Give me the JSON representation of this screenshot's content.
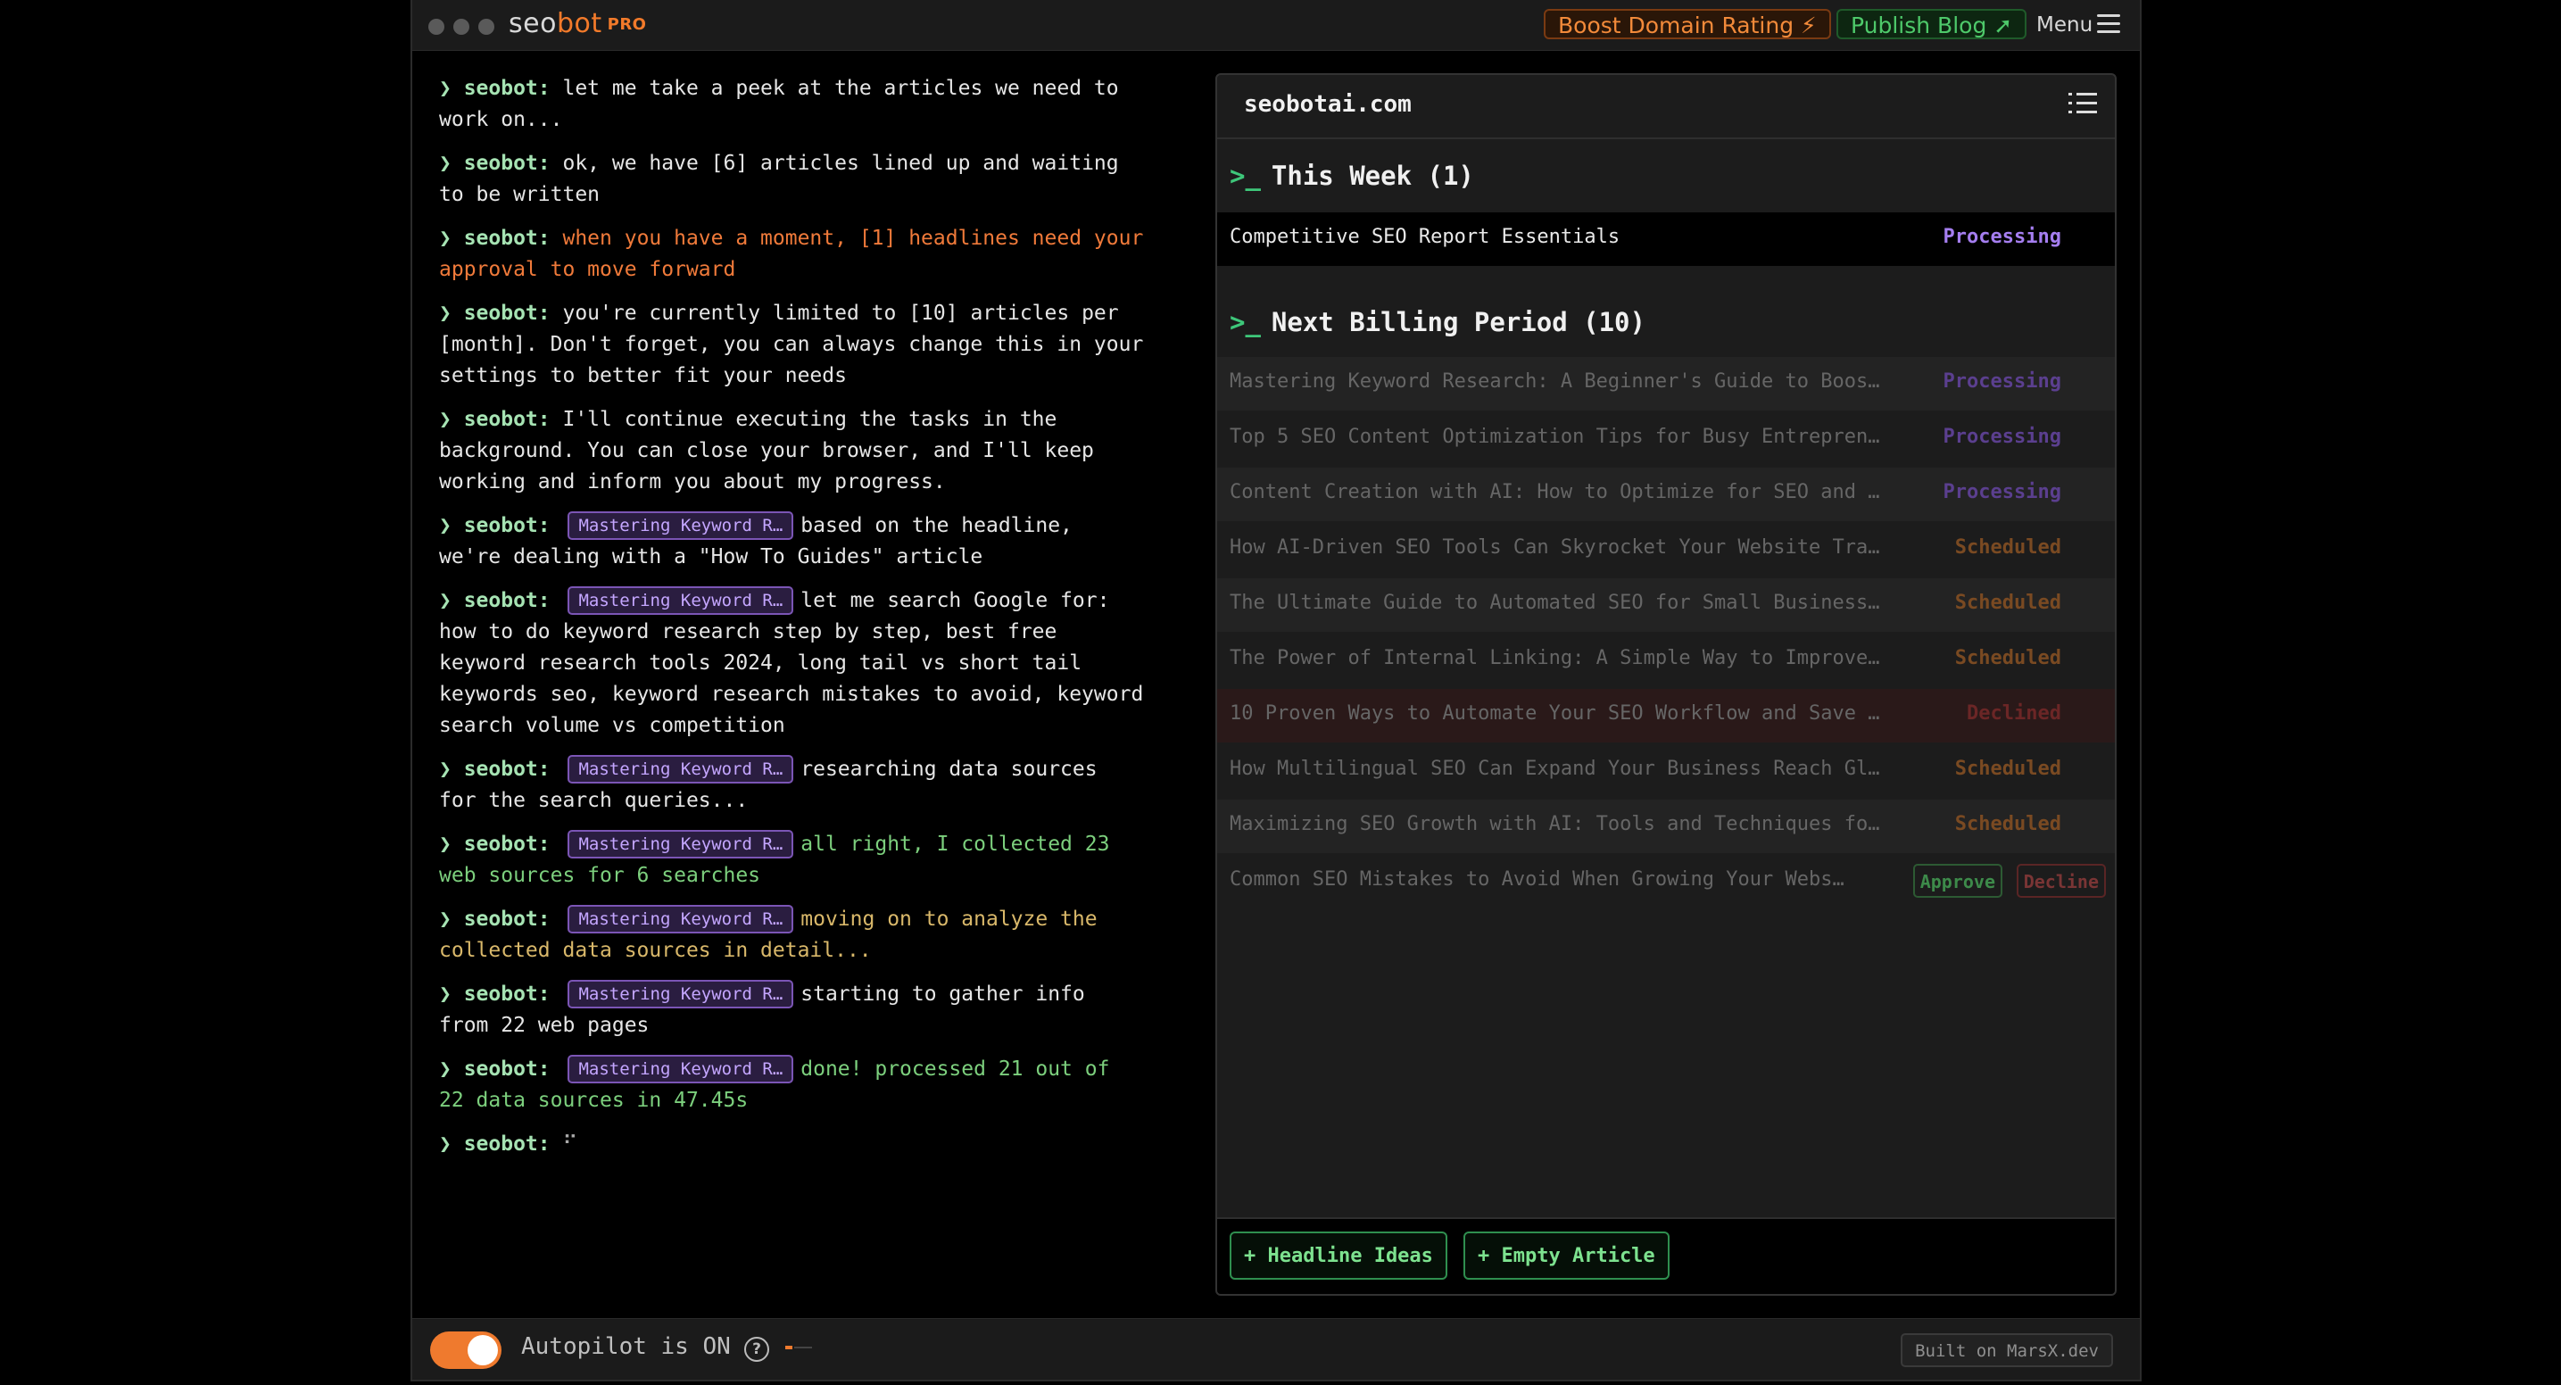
{
  "app": {
    "logo_main": "seo",
    "logo_accent": "bot",
    "logo_badge": "PRO",
    "boost_label": "Boost Domain Rating ⚡",
    "publish_label": "Publish Blog ➚",
    "menu_label": "Menu"
  },
  "log": {
    "prefix": "❯ seobot:",
    "entries": [
      {
        "text": "let me take a peek at the articles we need to work on..."
      },
      {
        "text": "ok, we have [6] articles lined up and waiting to be written"
      },
      {
        "text": "when you have a moment, [1] headlines need your approval to move forward"
      },
      {
        "text": "you're currently limited to [10] articles per [month]. Don't forget, you can always change this in your settings to better fit your needs"
      },
      {
        "text": "I'll continue executing the tasks in the background. You can close your browser, and I'll keep working and inform you about my progress."
      },
      {
        "chip": "Mastering Keyword R…",
        "text": "based on the headline, we're dealing with a \"How To Guides\" article"
      },
      {
        "chip": "Mastering Keyword R…",
        "text": "let me search Google for: how to do keyword research step by step, best free keyword research tools 2024, long tail vs short tail keywords seo, keyword research mistakes to avoid, keyword search volume vs competition"
      },
      {
        "chip": "Mastering Keyword R…",
        "text": "researching data sources for the search queries..."
      },
      {
        "chip": "Mastering Keyword R…",
        "text": "all right, I collected 23 web sources for 6 searches"
      },
      {
        "chip": "Mastering Keyword R…",
        "text": "moving on to analyze the collected data sources in detail..."
      },
      {
        "chip": "Mastering Keyword R…",
        "text": "starting to gather info from 22 web pages"
      },
      {
        "chip": "Mastering Keyword R…",
        "text": "done! processed 21 out of 22 data sources in 47.45s"
      },
      {
        "text": "⠋"
      }
    ]
  },
  "panel": {
    "site": "seobotai.com",
    "this_week_title": "This Week (1)",
    "current": {
      "title": "Competitive SEO Report Essentials",
      "status": "Processing"
    },
    "next_title": "Next Billing Period (10)",
    "prompt_glyph": ">_",
    "rows": [
      {
        "title": "Mastering Keyword Research: A Beginner's Guide to Boost…",
        "status": "Processing"
      },
      {
        "title": "Top 5 SEO Content Optimization Tips for Busy Entreprene…",
        "status": "Processing"
      },
      {
        "title": "Content Creation with AI: How to Optimize for SEO and U…",
        "status": "Processing"
      },
      {
        "title": "How AI-Driven SEO Tools Can Skyrocket Your Website Traf…",
        "status": "Scheduled"
      },
      {
        "title": "The Ultimate Guide to Automated SEO for Small Business …",
        "status": "Scheduled"
      },
      {
        "title": "The Power of Internal Linking: A Simple Way to Improve …",
        "status": "Scheduled"
      },
      {
        "title": "10 Proven Ways to Automate Your SEO Workflow and Save T…",
        "status": "Declined"
      },
      {
        "title": "How Multilingual SEO Can Expand Your Business Reach Glo…",
        "status": "Scheduled"
      },
      {
        "title": "Maximizing SEO Growth with AI: Tools and Techniques for…",
        "status": "Scheduled"
      },
      {
        "title": "Common SEO Mistakes to Avoid When Growing Your Website …",
        "approve": "Approve",
        "decline": "Decline"
      }
    ],
    "headline_ideas": "+ Headline Ideas",
    "empty_article": "+ Empty Article"
  },
  "status": {
    "autopilot": "Autopilot is ON",
    "help": "?",
    "built": "Built on MarsX.dev"
  }
}
